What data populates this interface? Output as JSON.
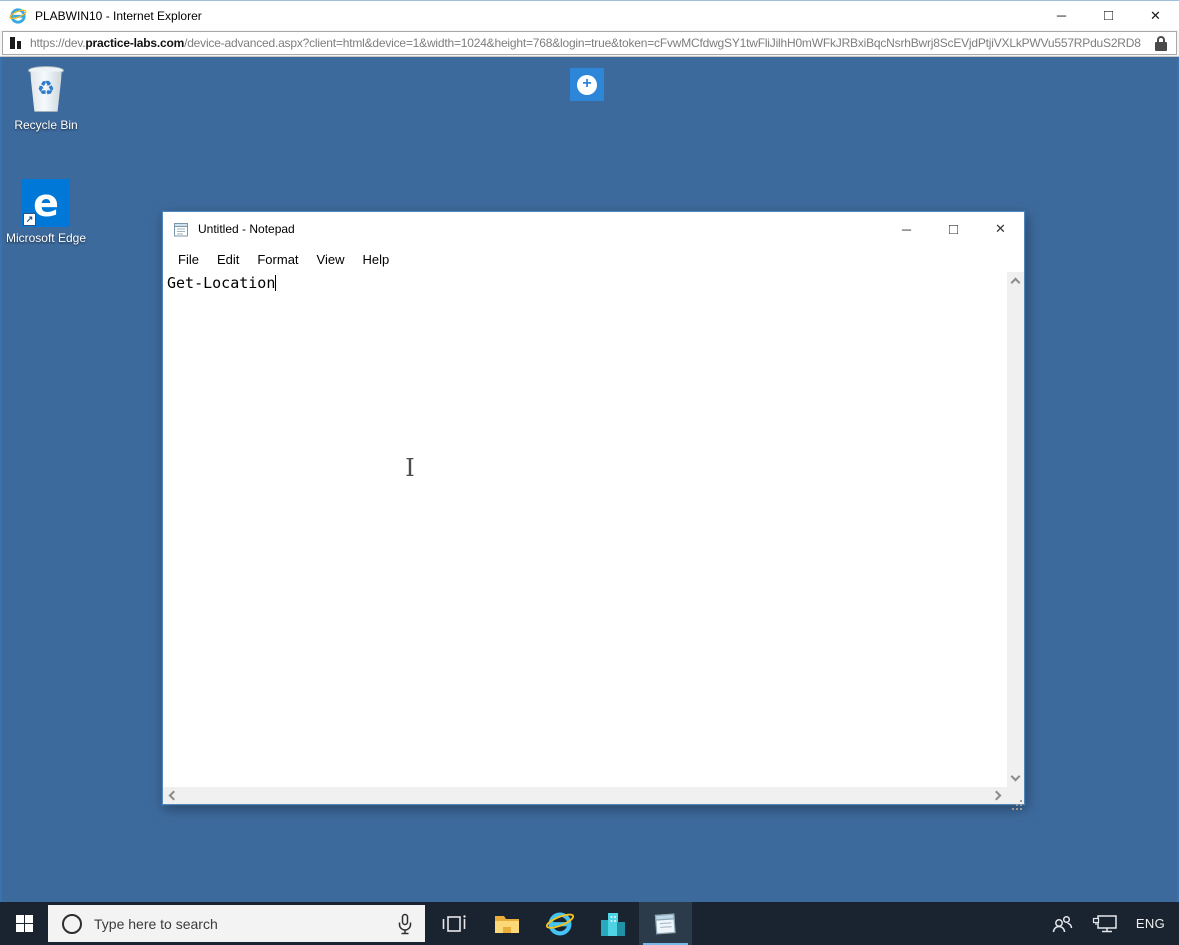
{
  "browser": {
    "title": "PLABWIN10 - Internet Explorer",
    "url": {
      "protocol": "https://dev.",
      "domain": "practice-labs.com",
      "path": "/device-advanced.aspx?client=html&device=1&width=1024&height=768&login=true&token=cFvwMCfdwgSY1twFliJilhH0mWFkJRBxiBqcNsrhBwrj8ScEVjdPtjiVXLkPWVu557RPduS2RD8"
    },
    "controls": {
      "minimize": "─",
      "maximize": "□",
      "close": "✕"
    }
  },
  "desktop": {
    "icons": [
      {
        "label": "Recycle Bin"
      },
      {
        "label": "Microsoft Edge"
      }
    ],
    "toolbar_expand_glyph": "+"
  },
  "notepad": {
    "title": "Untitled - Notepad",
    "menu": [
      "File",
      "Edit",
      "Format",
      "View",
      "Help"
    ],
    "content": "Get-Location",
    "controls": {
      "minimize": "─",
      "maximize": "□",
      "close": "✕"
    }
  },
  "taskbar": {
    "search_placeholder": "Type here to search",
    "language": "ENG"
  },
  "colors": {
    "desktop_bg": "#3d6a9d",
    "taskbar_bg": "#1a2330",
    "accent_blue": "#2e86d8",
    "active_task_underline": "#76b9e8",
    "edge_blue": "#0078d7",
    "notepad_border": "#4e86bc"
  }
}
